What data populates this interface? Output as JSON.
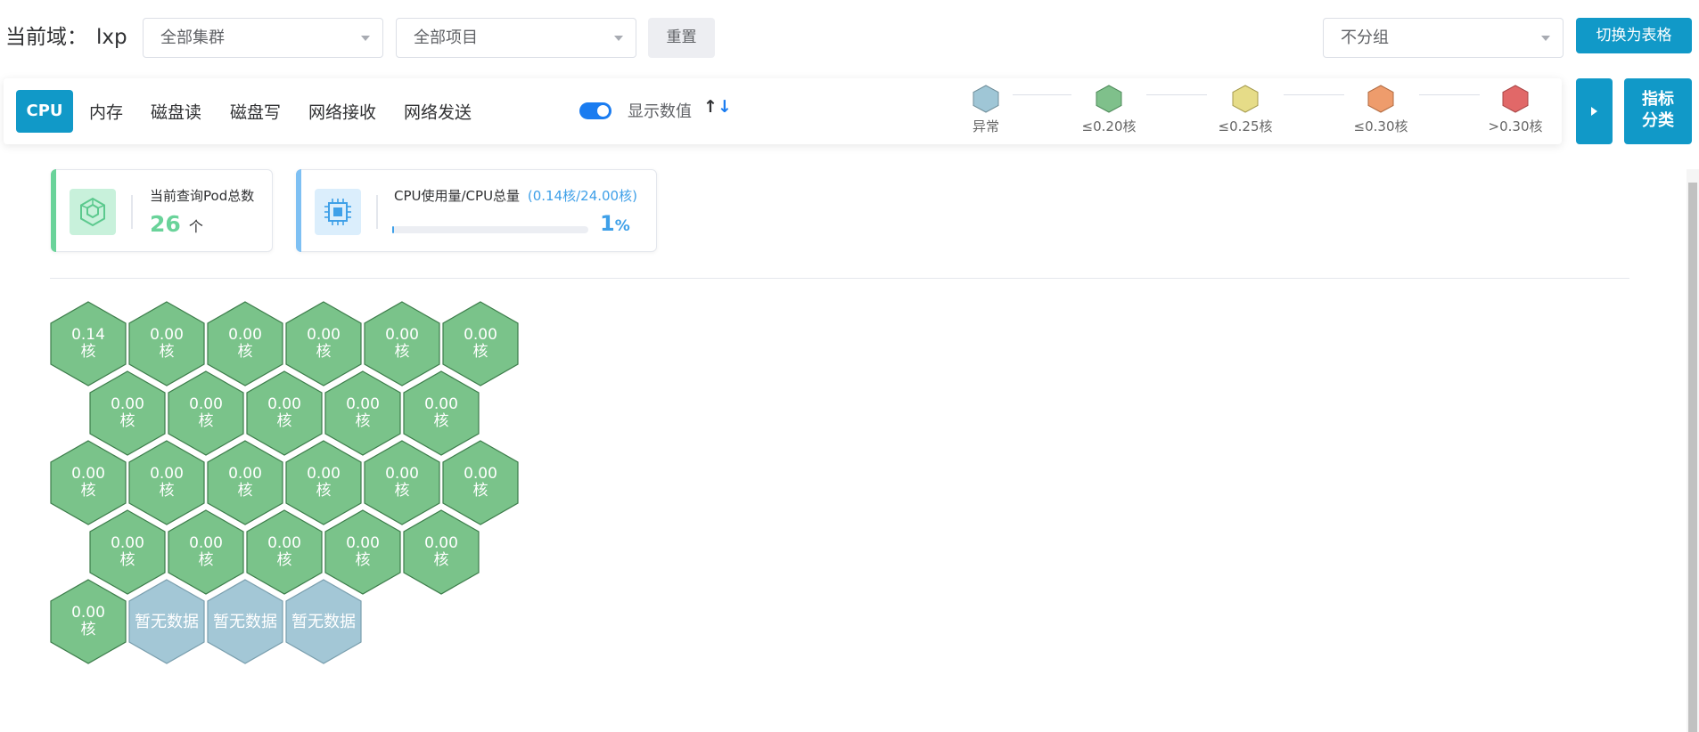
{
  "header": {
    "domain_label": "当前域：",
    "domain_value": "lxp",
    "cluster_select": "全部集群",
    "project_select": "全部项目",
    "reset_label": "重置",
    "group_select": "不分组",
    "switch_table_label": "切换为表格"
  },
  "toolbar": {
    "tabs": [
      "CPU",
      "内存",
      "磁盘读",
      "磁盘写",
      "网络接收",
      "网络发送"
    ],
    "active_tab": "CPU",
    "show_values_label": "显示数值",
    "show_values_on": true,
    "sort_icon": "↑↓",
    "legend": [
      {
        "label": "异常",
        "color": "#9fc6d6"
      },
      {
        "label": "≤0.20核",
        "color": "#7fc08b"
      },
      {
        "label": "≤0.25核",
        "color": "#e6dc88"
      },
      {
        "label": "≤0.30核",
        "color": "#ee9c6c"
      },
      {
        "label": ">0.30核",
        "color": "#e16868"
      }
    ],
    "play_icon": "play-icon",
    "classify_label_line1": "指标",
    "classify_label_line2": "分类"
  },
  "stats": {
    "pod_title": "当前查询Pod总数",
    "pod_count": "26",
    "pod_unit": "个",
    "cpu_title": "CPU使用量/CPU总量",
    "cpu_detail": "(0.14核/24.00核)",
    "cpu_percent": "1",
    "cpu_percent_unit": "%",
    "cpu_usage_fraction": 0.01
  },
  "colors": {
    "accent": "#1199c8",
    "hex_normal": "#7ac38a",
    "hex_nodata": "#a3c7d6",
    "pod_accent": "#6ad39a",
    "cpu_accent": "#3fa0e8"
  },
  "pods": [
    {
      "value": "0.14",
      "unit": "核",
      "status": "normal"
    },
    {
      "value": "0.00",
      "unit": "核",
      "status": "normal"
    },
    {
      "value": "0.00",
      "unit": "核",
      "status": "normal"
    },
    {
      "value": "0.00",
      "unit": "核",
      "status": "normal"
    },
    {
      "value": "0.00",
      "unit": "核",
      "status": "normal"
    },
    {
      "value": "0.00",
      "unit": "核",
      "status": "normal"
    },
    {
      "value": "0.00",
      "unit": "核",
      "status": "normal"
    },
    {
      "value": "0.00",
      "unit": "核",
      "status": "normal"
    },
    {
      "value": "0.00",
      "unit": "核",
      "status": "normal"
    },
    {
      "value": "0.00",
      "unit": "核",
      "status": "normal"
    },
    {
      "value": "0.00",
      "unit": "核",
      "status": "normal"
    },
    {
      "value": "0.00",
      "unit": "核",
      "status": "normal"
    },
    {
      "value": "0.00",
      "unit": "核",
      "status": "normal"
    },
    {
      "value": "0.00",
      "unit": "核",
      "status": "normal"
    },
    {
      "value": "0.00",
      "unit": "核",
      "status": "normal"
    },
    {
      "value": "0.00",
      "unit": "核",
      "status": "normal"
    },
    {
      "value": "0.00",
      "unit": "核",
      "status": "normal"
    },
    {
      "value": "0.00",
      "unit": "核",
      "status": "normal"
    },
    {
      "value": "0.00",
      "unit": "核",
      "status": "normal"
    },
    {
      "value": "0.00",
      "unit": "核",
      "status": "normal"
    },
    {
      "value": "0.00",
      "unit": "核",
      "status": "normal"
    },
    {
      "value": "0.00",
      "unit": "核",
      "status": "normal"
    },
    {
      "value": "0.00",
      "unit": "核",
      "status": "normal"
    },
    {
      "value": "暂无数据",
      "unit": "",
      "status": "nodata"
    },
    {
      "value": "暂无数据",
      "unit": "",
      "status": "nodata"
    },
    {
      "value": "暂无数据",
      "unit": "",
      "status": "nodata"
    }
  ]
}
